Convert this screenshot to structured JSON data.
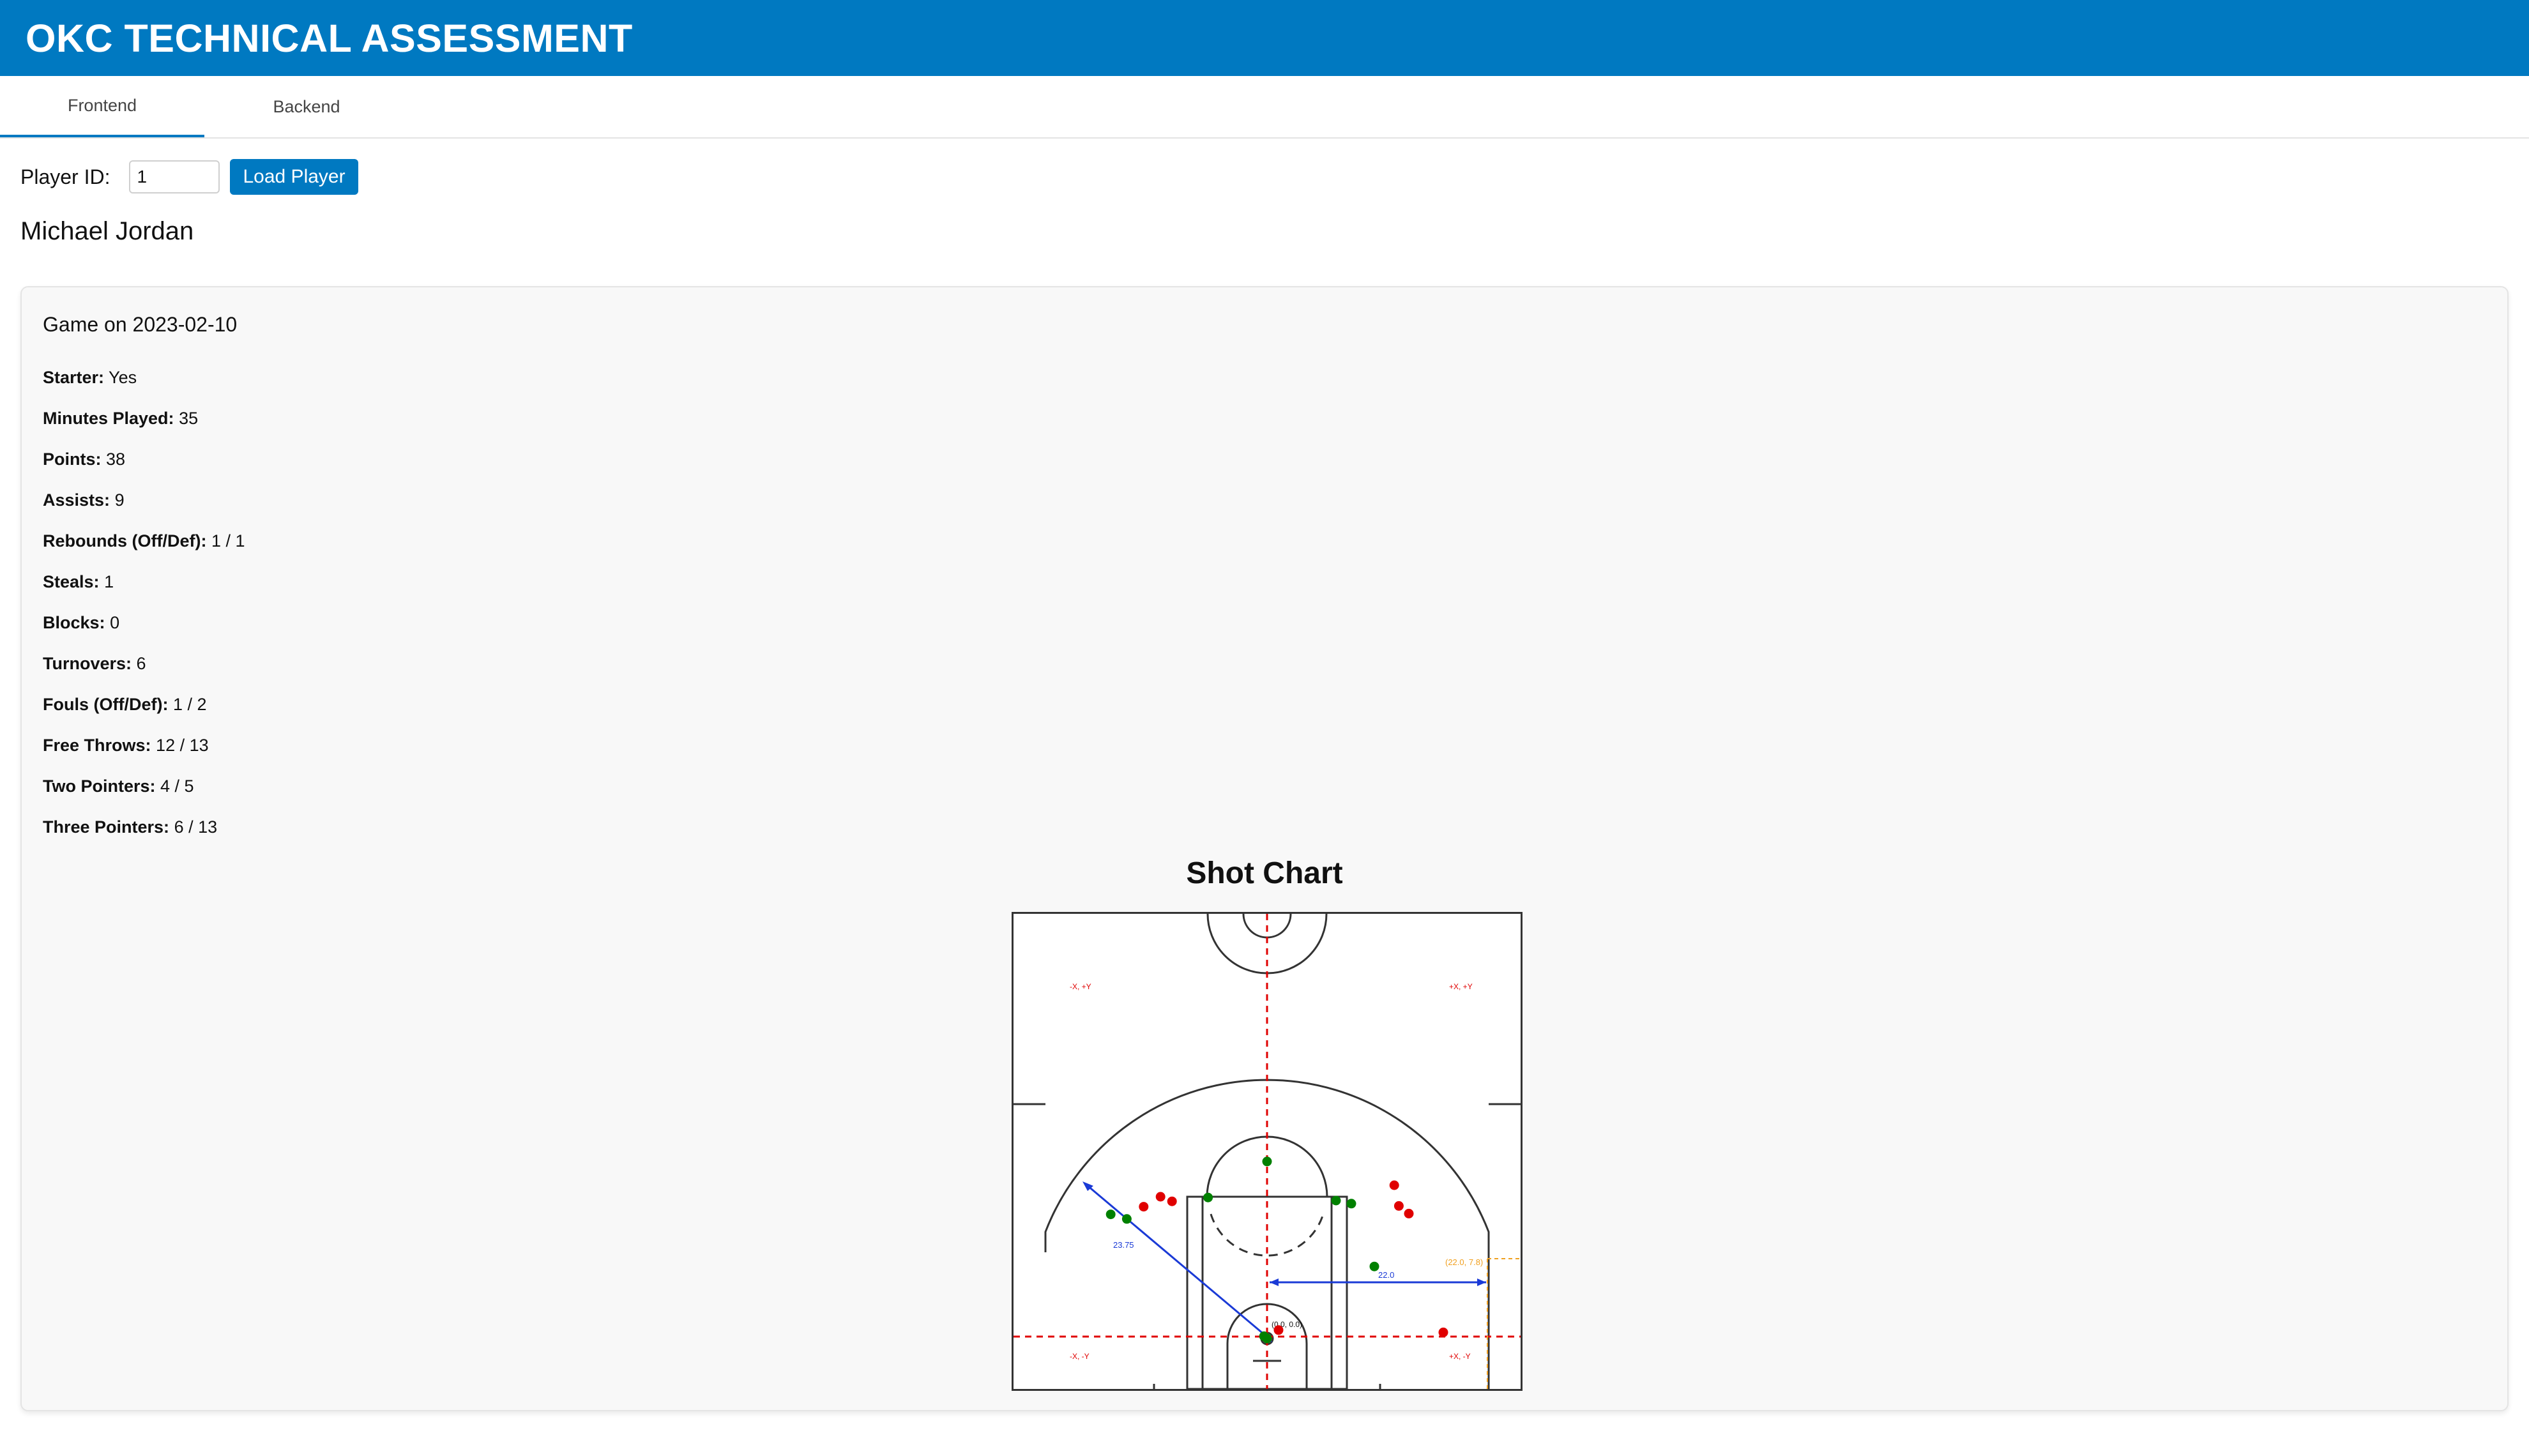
{
  "header": {
    "title": "OKC TECHNICAL ASSESSMENT"
  },
  "tabs": [
    {
      "label": "Frontend",
      "active": true
    },
    {
      "label": "Backend",
      "active": false
    }
  ],
  "player_form": {
    "label": "Player ID:",
    "value": "1",
    "button_label": "Load Player"
  },
  "player": {
    "name": "Michael Jordan"
  },
  "game": {
    "title": "Game on 2023-02-10",
    "stats": [
      {
        "label": "Starter:",
        "value": "Yes"
      },
      {
        "label": "Minutes Played:",
        "value": "35"
      },
      {
        "label": "Points:",
        "value": "38"
      },
      {
        "label": "Assists:",
        "value": "9"
      },
      {
        "label": "Rebounds (Off/Def):",
        "value": "1 / 1"
      },
      {
        "label": "Steals:",
        "value": "1"
      },
      {
        "label": "Blocks:",
        "value": "0"
      },
      {
        "label": "Turnovers:",
        "value": "6"
      },
      {
        "label": "Fouls (Off/Def):",
        "value": "1 / 2"
      },
      {
        "label": "Free Throws:",
        "value": "12 / 13"
      },
      {
        "label": "Two Pointers:",
        "value": "4 / 5"
      },
      {
        "label": "Three Pointers:",
        "value": "6 / 13"
      }
    ]
  },
  "shot_chart": {
    "title": "Shot Chart",
    "quadrant_labels": {
      "top_left": "-X, +Y",
      "top_right": "+X, +Y",
      "bottom_left": "-X, -Y",
      "bottom_right": "+X, -Y"
    },
    "annotations": {
      "three_radius": "23.75",
      "corner_distance": "22.0",
      "corner_point": "(22.0, 7.8)",
      "origin": "(0.0, 0.0)"
    },
    "colors": {
      "made": "#008000",
      "missed": "#e00000",
      "axes": "#e00000",
      "measure": "#1a3ad6",
      "corner": "#f0a020"
    },
    "shots": [
      {
        "x": 0.0,
        "y": 23.1,
        "made": true
      },
      {
        "x": -13.9,
        "y": 18.5,
        "made": false
      },
      {
        "x": -16.1,
        "y": 17.2,
        "made": false
      },
      {
        "x": -12.4,
        "y": 17.9,
        "made": false
      },
      {
        "x": -7.7,
        "y": 18.4,
        "made": true
      },
      {
        "x": -20.4,
        "y": 16.2,
        "made": true
      },
      {
        "x": -18.3,
        "y": 15.6,
        "made": true
      },
      {
        "x": 9.0,
        "y": 18.0,
        "made": true
      },
      {
        "x": 11.0,
        "y": 17.6,
        "made": true
      },
      {
        "x": 16.6,
        "y": 20.0,
        "made": false
      },
      {
        "x": 17.2,
        "y": 17.3,
        "made": false
      },
      {
        "x": 18.5,
        "y": 16.3,
        "made": false
      },
      {
        "x": 14.0,
        "y": 9.4,
        "made": true
      },
      {
        "x": 1.5,
        "y": 1.1,
        "made": false
      },
      {
        "x": -0.4,
        "y": 0.3,
        "made": true
      },
      {
        "x": 0.0,
        "y": 0.0,
        "made": true
      },
      {
        "x": 23.0,
        "y": 0.8,
        "made": false
      }
    ]
  }
}
